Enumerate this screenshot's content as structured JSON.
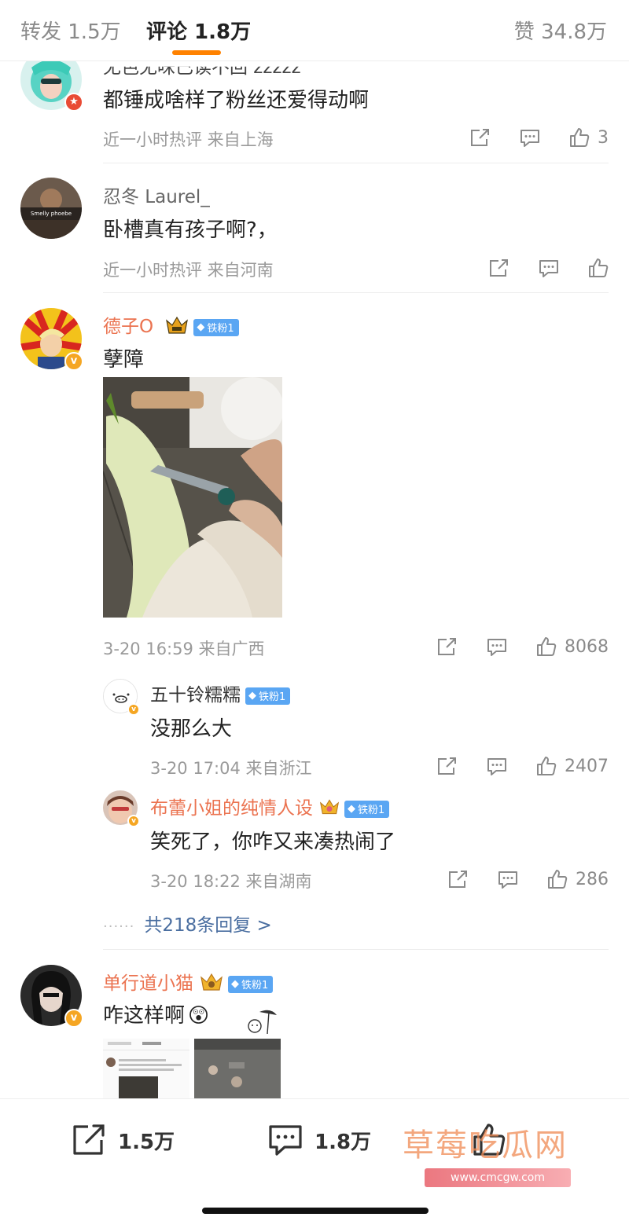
{
  "tabs": {
    "repost": "转发 1.5万",
    "comment": "评论 1.8万",
    "like": "赞 34.8万",
    "accent": "#ff8200"
  },
  "comments": [
    {
      "name_partial": "无色无味已读不回 zzzzz",
      "text": "都锤成啥样了粉丝还爱得动啊",
      "meta": "近一小时热评  来自上海",
      "like_count": "3"
    },
    {
      "name": "忍冬 Laurel_",
      "text": "卧槽真有孩子啊?，",
      "meta": "近一小时热评  来自河南",
      "like_count": ""
    },
    {
      "name": "德子O",
      "fan_badge": "铁粉1",
      "text": "孽障",
      "meta": "3-20 16:59  来自广西",
      "like_count": "8068",
      "replies": [
        {
          "name": "五十铃糯糯",
          "fan_badge": "铁粉1",
          "text": "没那么大",
          "meta": "3-20 17:04  来自浙江",
          "like_count": "2407"
        },
        {
          "name": "布蕾小姐的纯情人设",
          "fan_badge": "铁粉1",
          "text": "笑死了，你咋又来凑热闹了",
          "meta": "3-20 18:22  来自湖南",
          "like_count": "286"
        }
      ],
      "more_replies": "共218条回复 >"
    },
    {
      "name": "单行道小猫",
      "fan_badge": "铁粉1",
      "text": "咋这样啊",
      "emoji": "😲"
    }
  ],
  "bottom_bar": {
    "repost": "1.5万",
    "comment": "1.8万"
  },
  "watermark": {
    "title": "草莓吃瓜网",
    "url": "www.cmcgw.com"
  },
  "colors": {
    "vip_name": "#eb7350",
    "link": "#4a6ea0",
    "fan_badge": "#5aa6f3"
  }
}
